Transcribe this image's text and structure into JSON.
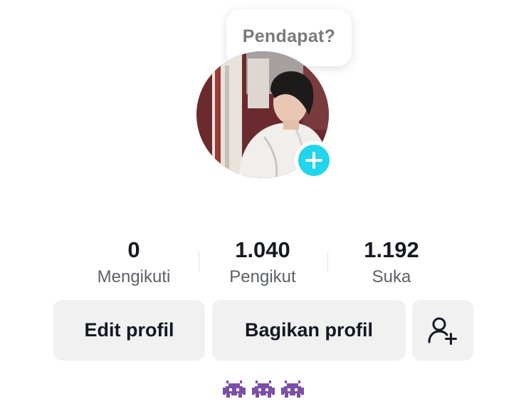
{
  "bubble": {
    "text": "Pendapat?"
  },
  "avatar": {
    "icon": "profile-photo",
    "add_icon": "plus-icon",
    "accent": "#20d5ec"
  },
  "stats": [
    {
      "value": "0",
      "label": "Mengikuti"
    },
    {
      "value": "1.040",
      "label": "Pengikut"
    },
    {
      "value": "1.192",
      "label": "Suka"
    }
  ],
  "buttons": {
    "edit_profile": "Edit profil",
    "share_profile": "Bagikan profil",
    "add_friend_icon": "person-add-icon"
  },
  "bio": {
    "emoji_count": 3,
    "emoji_icon": "alien-monster-icon",
    "emoji_color": "#7b4fa6"
  }
}
